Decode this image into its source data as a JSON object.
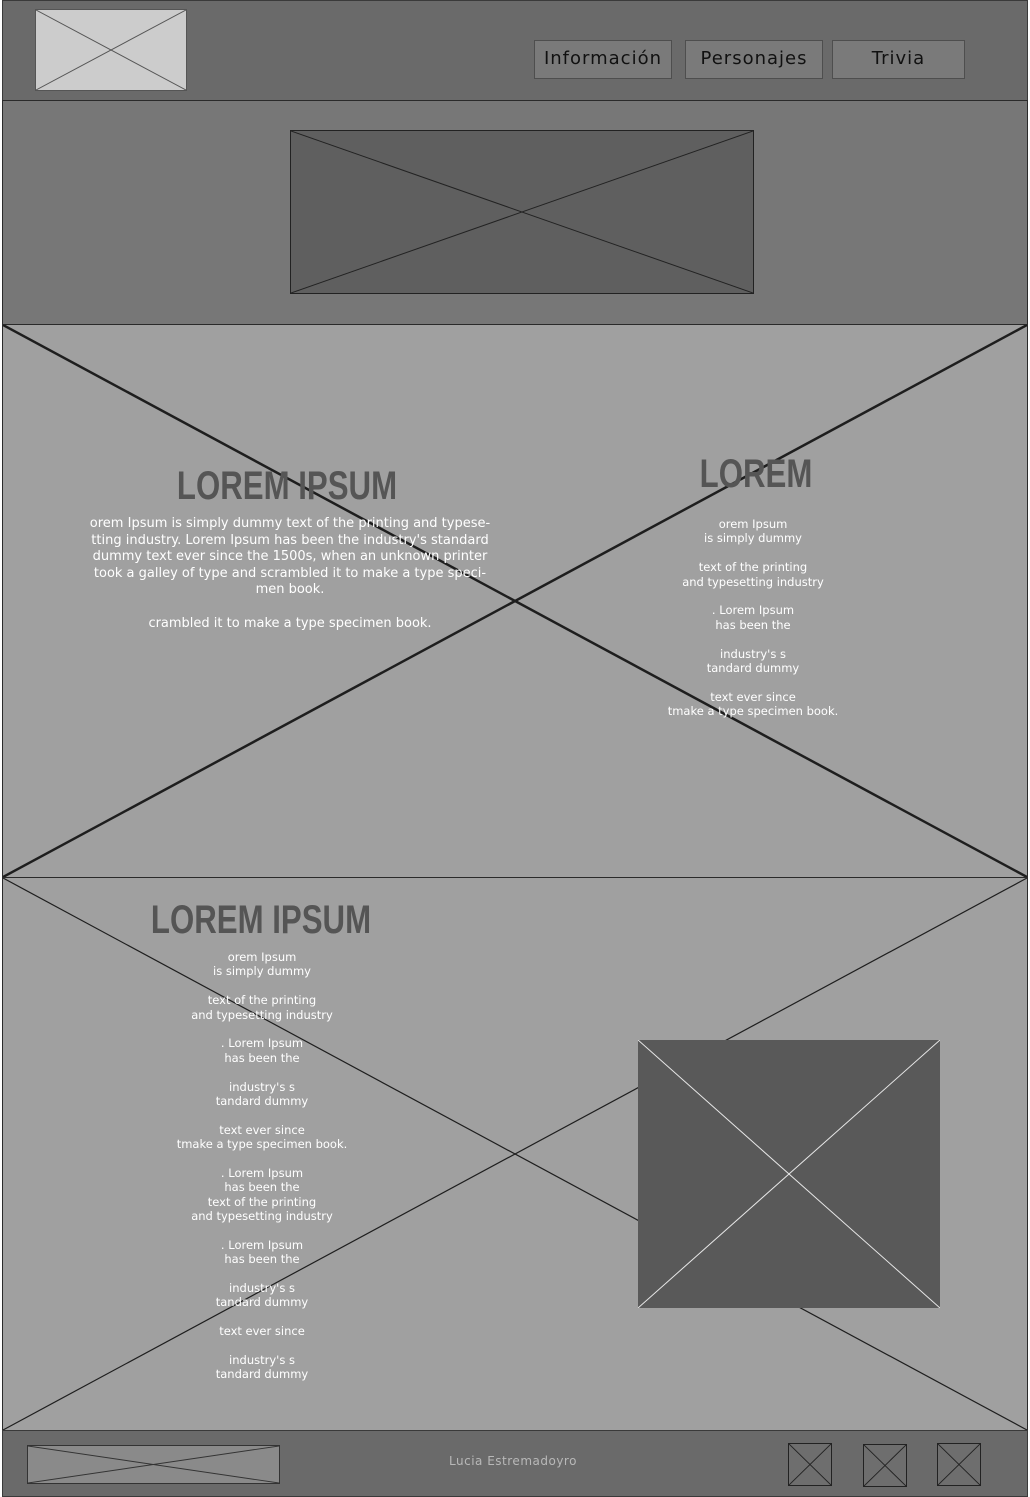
{
  "header": {
    "logo_icon": "image-placeholder-icon",
    "nav": [
      {
        "label": "Información"
      },
      {
        "label": "Personajes"
      },
      {
        "label": "Trivia"
      }
    ]
  },
  "banner": {
    "image_icon": "image-placeholder-icon"
  },
  "section_one": {
    "background_icon": "image-placeholder-icon",
    "left": {
      "heading": "LOREM IPSUM",
      "paragraph_lines": [
        "orem Ipsum is simply dummy text of the printing and typese-",
        "tting industry. Lorem Ipsum has been the industry's standard",
        "dummy text ever since the 1500s, when an unknown printer",
        "took a galley of type and scrambled it to make a type speci-",
        "men book."
      ],
      "paragraph_two": "crambled it to make a type specimen book."
    },
    "right": {
      "heading": "LOREM",
      "lines": [
        "orem Ipsum",
        "is simply dummy",
        "",
        "text of the printing",
        "and typesetting industry",
        "",
        ". Lorem Ipsum",
        "has been the",
        "",
        "industry's s",
        "tandard dummy",
        "",
        "text ever since",
        "tmake a type specimen book."
      ]
    }
  },
  "section_two": {
    "background_icon": "image-placeholder-icon",
    "heading": "LOREM IPSUM",
    "lines": [
      "orem Ipsum",
      "is simply dummy",
      "",
      "text of the printing",
      "and typesetting industry",
      "",
      ". Lorem Ipsum",
      "has been the",
      "",
      "industry's s",
      "tandard dummy",
      "",
      "text ever since",
      "tmake a type specimen book.",
      "",
      ". Lorem Ipsum",
      "has been the",
      "text of the printing",
      "and typesetting industry",
      "",
      ". Lorem Ipsum",
      "has been the",
      "",
      "industry's s",
      "tandard dummy",
      "",
      "text ever since",
      "",
      "industry's s",
      "tandard dummy"
    ],
    "image_icon": "image-placeholder-icon"
  },
  "footer": {
    "logo_icon": "image-placeholder-icon",
    "credit": "Lucia Estremadoyro",
    "social_icons": [
      "image-placeholder-icon",
      "image-placeholder-icon",
      "image-placeholder-icon"
    ]
  },
  "colors": {
    "header_bg": "#6a6a6a",
    "banner_bg": "#777777",
    "section_bg": "#a0a0a0",
    "dark_placeholder": "#5a5a5a",
    "heading_color": "#555555",
    "footer_bg": "#6a6a6a"
  }
}
